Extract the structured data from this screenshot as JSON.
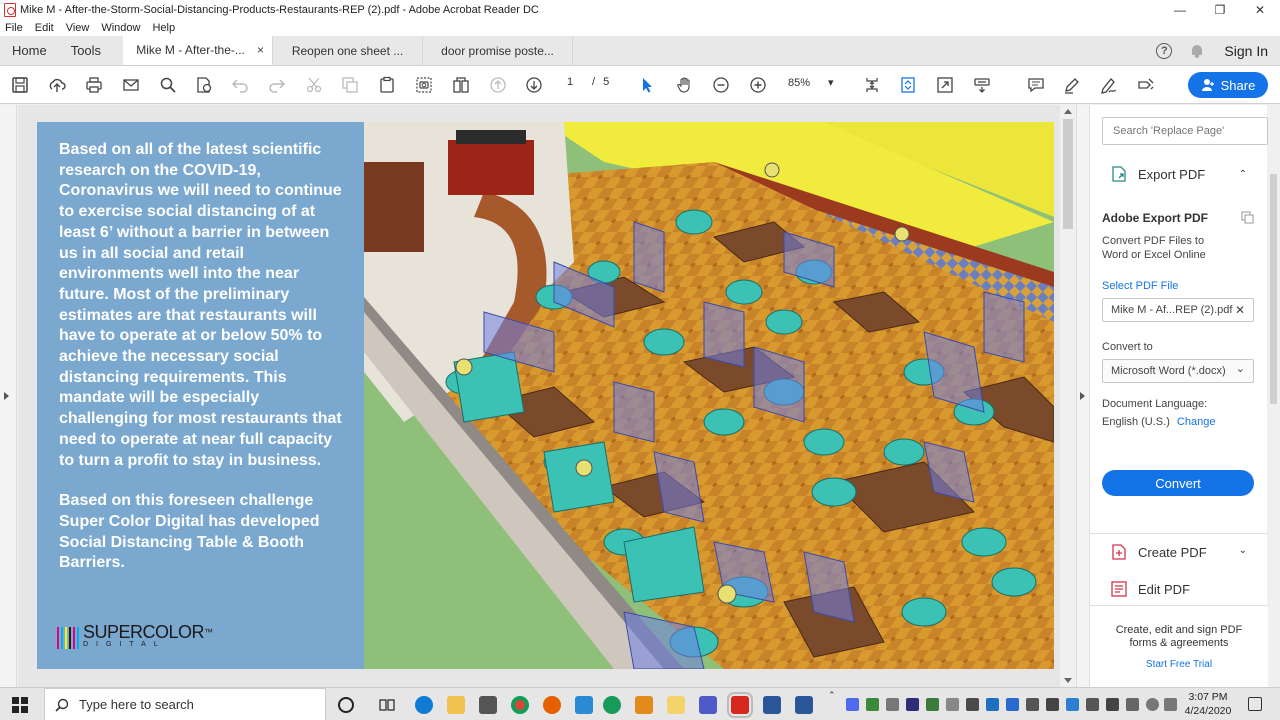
{
  "window": {
    "title": "Mike M - After-the-Storm-Social-Distancing-Products-Restaurants-REP (2).pdf - Adobe Acrobat Reader DC",
    "controls": {
      "minimize": "—",
      "maximize": "❐",
      "close": "✕"
    }
  },
  "menu": [
    "File",
    "Edit",
    "View",
    "Window",
    "Help"
  ],
  "tabs": {
    "home": "Home",
    "tools": "Tools",
    "docs": [
      {
        "label": "Mike M - After-the-...",
        "active": true
      },
      {
        "label": "Reopen one sheet ...",
        "active": false
      },
      {
        "label": "door promise poste...",
        "active": false
      }
    ],
    "close_glyph": "×",
    "help_glyph": "?",
    "sign_in": "Sign In"
  },
  "toolbar": {
    "current_page": "1",
    "page_sep": "/",
    "total_pages": "5",
    "zoom": "85%",
    "zoom_chevron": "▾",
    "share": "Share"
  },
  "document": {
    "paragraphs": [
      "Based on all of the latest scientific research on the COVID-19, Coronavirus we will need to continue to exercise social distancing of at least 6’ without a barrier in between us in all social and retail environments well into the near future. Most of the preliminary estimates are that restaurants will have to operate at or below 50% to achieve the necessary social distancing requirements. This mandate will be especially challenging for most restaurants that need to operate at near full capacity to turn a profit to stay in business.",
      "Based on this foreseen challenge Super Color Digital has developed Social Distancing Table & Booth Barriers."
    ],
    "logo_main": "SUPERCOLOR",
    "logo_tm": "™",
    "logo_sub": "DIGITAL",
    "logo_bar_colors": [
      "#e4007c",
      "#00aeef",
      "#fff200",
      "#231f20",
      "#e4007c",
      "#00aeef"
    ]
  },
  "right_panel": {
    "search_placeholder": "Search 'Replace Page'",
    "export_pdf": "Export PDF",
    "adobe_export_title": "Adobe Export PDF",
    "convert_desc": "Convert PDF Files to Word or Excel Online",
    "select_file_label": "Select PDF File",
    "selected_file": "Mike M - Af...REP (2).pdf",
    "file_remove_glyph": "✕",
    "convert_to_label": "Convert to",
    "convert_to_value": "Microsoft Word (*.docx)",
    "dropdown_chevron": "⌄",
    "doc_language_label": "Document Language:",
    "doc_language_value": "English (U.S.)",
    "change_link": "Change",
    "convert_button": "Convert",
    "create_pdf": "Create PDF",
    "edit_pdf": "Edit PDF",
    "chev_up": "⌃",
    "chev_down": "⌄",
    "footer_text": "Create, edit and sign PDF forms & agreements",
    "free_trial": "Start Free Trial",
    "accent": "#1473e6"
  },
  "taskbar": {
    "search_placeholder": "Type here to search",
    "time": "3:07 PM",
    "date": "4/24/2020"
  }
}
